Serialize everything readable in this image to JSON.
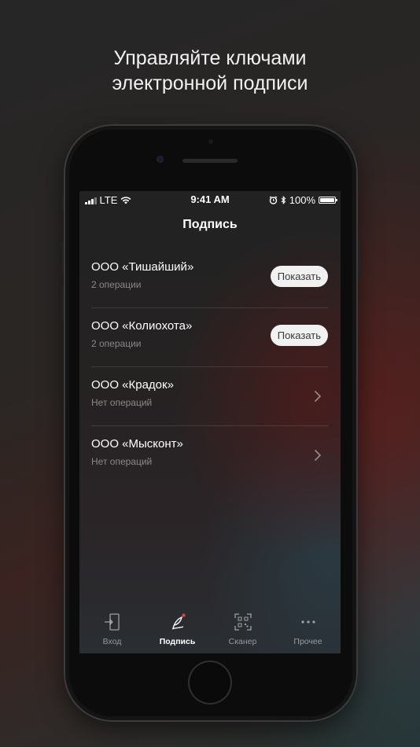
{
  "headline": {
    "line1": "Управляйте ключами",
    "line2": "электронной подписи"
  },
  "status_bar": {
    "carrier": "LTE",
    "time": "9:41 AM",
    "battery": "100%"
  },
  "screen": {
    "title": "Подпись"
  },
  "organizations": [
    {
      "name": "ООО «Тишайший»",
      "operations": "2 операции",
      "action": "Показать"
    },
    {
      "name": "ООО «Колиохота»",
      "operations": "2 операции",
      "action": "Показать"
    },
    {
      "name": "ООО «Крадок»",
      "operations": "Нет операций"
    },
    {
      "name": "ООО «Мысконт»",
      "operations": "Нет операций"
    }
  ],
  "tabs": [
    {
      "label": "Вход",
      "icon": "login-icon"
    },
    {
      "label": "Подпись",
      "icon": "signature-pen-icon",
      "active": true
    },
    {
      "label": "Сканер",
      "icon": "qr-scanner-icon"
    },
    {
      "label": "Прочее",
      "icon": "more-icon"
    }
  ],
  "colors": {
    "accent_dot": "#e0403a",
    "button_bg": "#f1f1f1"
  }
}
